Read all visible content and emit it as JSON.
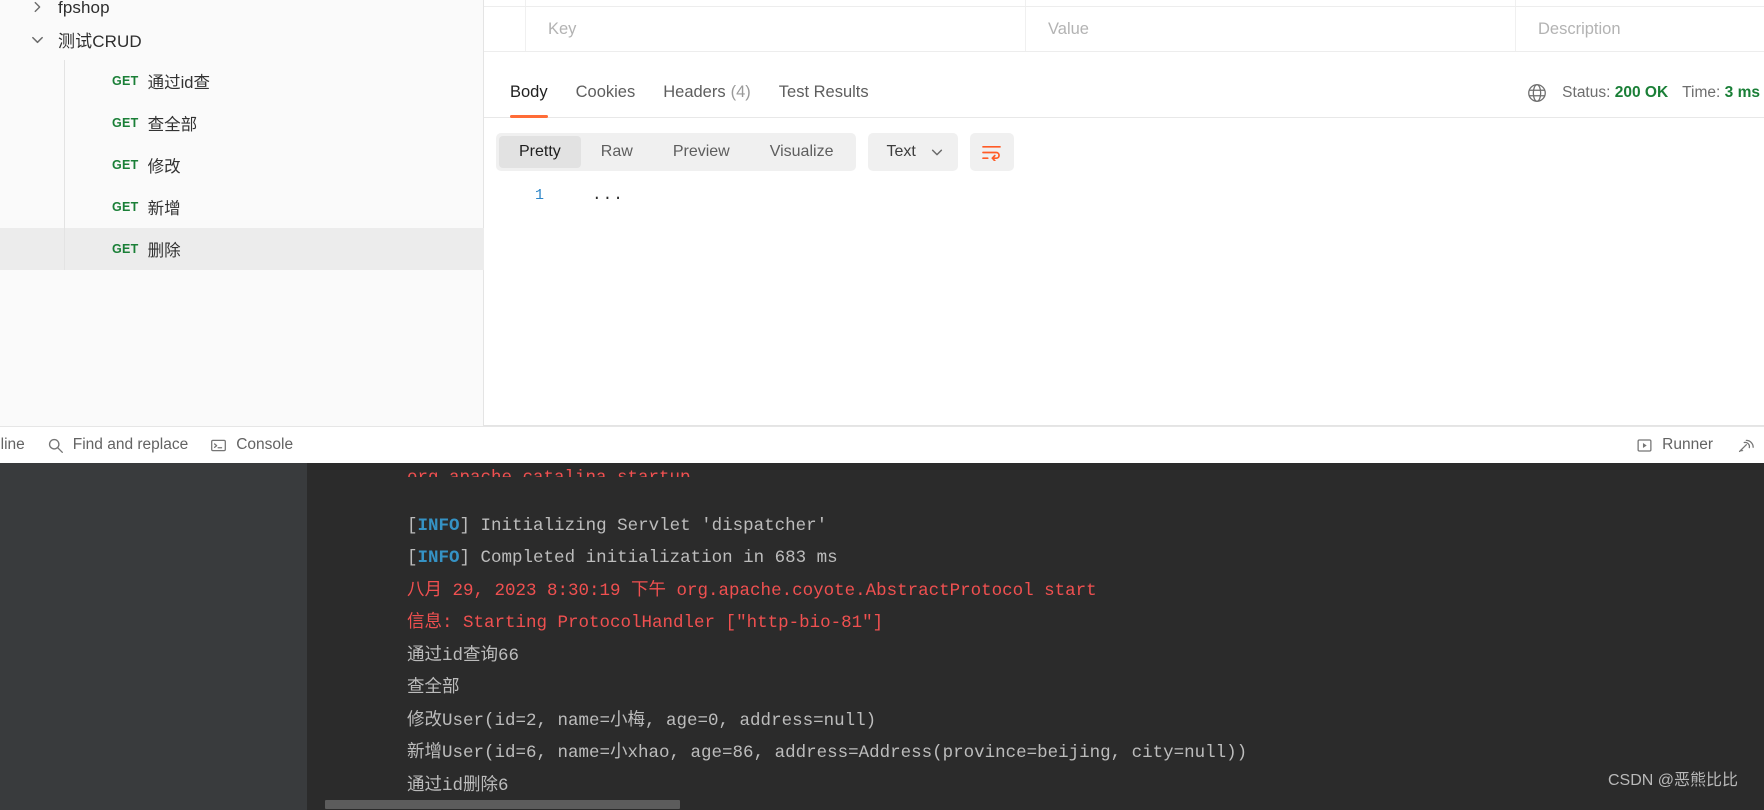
{
  "sidebar": {
    "clipped_folder": {
      "label": "fpshop",
      "icon": "chevron-right-icon",
      "expanded": false
    },
    "folder": {
      "label": "测试CRUD",
      "icon": "chevron-down-icon",
      "expanded": true
    },
    "requests": [
      {
        "method": "GET",
        "name": "通过id查",
        "selected": false
      },
      {
        "method": "GET",
        "name": "查全部",
        "selected": false
      },
      {
        "method": "GET",
        "name": "修改",
        "selected": false
      },
      {
        "method": "GET",
        "name": "新增",
        "selected": false
      },
      {
        "method": "GET",
        "name": "删除",
        "selected": true
      }
    ]
  },
  "params_table": {
    "columns": [
      {
        "key": "key",
        "placeholder": "Key"
      },
      {
        "key": "value",
        "placeholder": "Value"
      },
      {
        "key": "description",
        "placeholder": "Description"
      }
    ]
  },
  "response": {
    "tabs": [
      {
        "label": "Body",
        "active": true,
        "count": ""
      },
      {
        "label": "Cookies",
        "active": false,
        "count": ""
      },
      {
        "label": "Headers",
        "active": false,
        "count": "(4)"
      },
      {
        "label": "Test Results",
        "active": false,
        "count": ""
      }
    ],
    "status": {
      "globe_icon": "globe-icon",
      "status_label": "Status:",
      "status_value": "200 OK",
      "time_label": "Time:",
      "time_value": "3 ms",
      "value_color": "#1a7f37"
    },
    "view_modes": [
      {
        "label": "Pretty",
        "active": true
      },
      {
        "label": "Raw",
        "active": false
      },
      {
        "label": "Preview",
        "active": false
      },
      {
        "label": "Visualize",
        "active": false
      }
    ],
    "format_select": {
      "value": "Text",
      "icon": "chevron-down-icon"
    },
    "wrap_button": {
      "icon": "word-wrap-icon",
      "color": "#ff5b26"
    },
    "body_lines": [
      {
        "number": "1",
        "text": "..."
      }
    ]
  },
  "status_bar": {
    "left_items": [
      {
        "label": "nline",
        "icon": "",
        "truncated": true
      },
      {
        "label": "Find and replace",
        "icon": "search-icon",
        "truncated": false
      },
      {
        "label": "Console",
        "icon": "terminal-icon",
        "truncated": false
      }
    ],
    "right_items": [
      {
        "label": "Runner",
        "icon": "play-box-icon"
      },
      {
        "label": "",
        "icon": "satellite-icon"
      }
    ]
  },
  "console": {
    "lines": [
      {
        "clipped": true,
        "segments": [
          {
            "text": "org.apache.catalina.startup",
            "cls": "c-red"
          }
        ]
      },
      {
        "clipped": false,
        "segments": [
          {
            "text": "[",
            "cls": "c-gray"
          },
          {
            "text": "INFO",
            "cls": "c-blue"
          },
          {
            "text": "] Initializing Servlet 'dispatcher'",
            "cls": "c-gray"
          }
        ]
      },
      {
        "clipped": false,
        "segments": [
          {
            "text": "[",
            "cls": "c-gray"
          },
          {
            "text": "INFO",
            "cls": "c-blue"
          },
          {
            "text": "] Completed initialization in 683 ms",
            "cls": "c-gray"
          }
        ]
      },
      {
        "clipped": false,
        "segments": [
          {
            "text": "八月 29, 2023 8:30:19 下午 org.apache.coyote.AbstractProtocol start",
            "cls": "c-red"
          }
        ]
      },
      {
        "clipped": false,
        "segments": [
          {
            "text": "信息: Starting ProtocolHandler [\"http-bio-81\"]",
            "cls": "c-red"
          }
        ]
      },
      {
        "clipped": false,
        "segments": [
          {
            "text": "通过id查询66",
            "cls": "c-gray"
          }
        ]
      },
      {
        "clipped": false,
        "segments": [
          {
            "text": "查全部",
            "cls": "c-gray"
          }
        ]
      },
      {
        "clipped": false,
        "segments": [
          {
            "text": "修改User(id=2, name=小梅, age=0, address=null)",
            "cls": "c-gray"
          }
        ]
      },
      {
        "clipped": false,
        "segments": [
          {
            "text": "新增User(id=6, name=小xhao, age=86, address=Address(province=beijing, city=null))",
            "cls": "c-gray"
          }
        ]
      },
      {
        "clipped": false,
        "segments": [
          {
            "text": "通过id删除6",
            "cls": "c-gray"
          }
        ]
      }
    ],
    "watermark": "CSDN @恶熊比比"
  }
}
